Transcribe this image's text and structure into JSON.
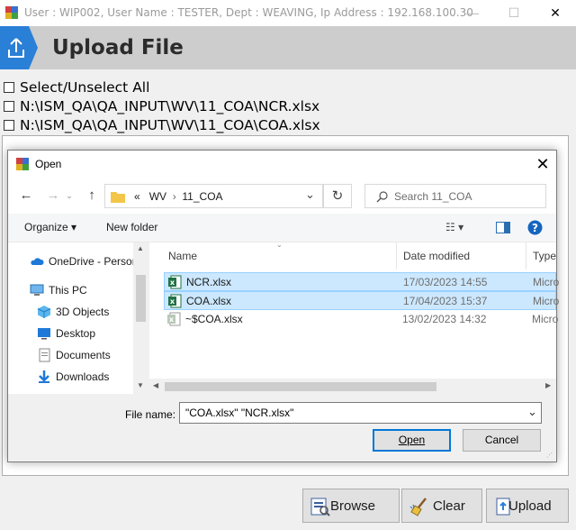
{
  "window": {
    "title": "User : WIP002, User Name : TESTER, Dept : WEAVING, Ip Address : 192.168.100.30",
    "minimize_glyph": "—",
    "maximize_glyph": "☐",
    "close_glyph": "✕"
  },
  "banner": {
    "title": "Upload File",
    "icon": "upload-icon"
  },
  "checklist": {
    "select_all": "Select/Unselect All",
    "items": [
      "N:\\ISM_QA\\QA_INPUT\\WV\\11_COA\\NCR.xlsx",
      "N:\\ISM_QA\\QA_INPUT\\WV\\11_COA\\COA.xlsx"
    ]
  },
  "buttons": {
    "browse": "Browse",
    "clear": "Clear",
    "upload": "Upload"
  },
  "dialog": {
    "title": "Open",
    "close_glyph": "✕",
    "nav": {
      "back": "←",
      "forward": "→",
      "up": "↑",
      "refresh": "↻"
    },
    "address": {
      "prefix": "«",
      "parts": [
        "WV",
        "11_COA"
      ],
      "sep": "›",
      "dropdown": "⌄"
    },
    "search_placeholder": "Search 11_COA",
    "toolbar": {
      "organize": "Organize ▾",
      "new_folder": "New folder",
      "views": "☷ ▾"
    },
    "navpane": [
      {
        "label": "OneDrive - Person",
        "icon": "cloud-icon"
      },
      {
        "label": "This PC",
        "icon": "computer-icon"
      },
      {
        "label": "3D Objects",
        "icon": "cube-icon"
      },
      {
        "label": "Desktop",
        "icon": "desktop-icon"
      },
      {
        "label": "Documents",
        "icon": "documents-icon"
      },
      {
        "label": "Downloads",
        "icon": "downloads-icon"
      }
    ],
    "columns": {
      "name": "Name",
      "date": "Date modified",
      "type": "Type"
    },
    "files": [
      {
        "name": "NCR.xlsx",
        "date": "17/03/2023 14:55",
        "type": "Micro",
        "icon": "excel-file-icon"
      },
      {
        "name": "COA.xlsx",
        "date": "17/04/2023 15:37",
        "type": "Micro",
        "icon": "excel-file-icon"
      },
      {
        "name": "~$COA.xlsx",
        "date": "13/02/2023 14:32",
        "type": "Micro",
        "icon": "excel-temp-file-icon"
      }
    ],
    "file_name_label": "File name:",
    "file_name_value": "\"COA.xlsx\" \"NCR.xlsx\"",
    "open": "Open",
    "cancel": "Cancel"
  }
}
